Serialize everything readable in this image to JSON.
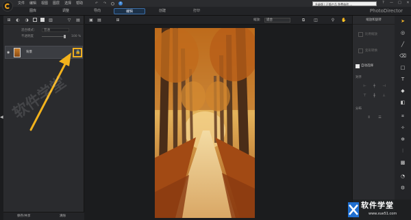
{
  "app": {
    "brand": "PhotoDirector"
  },
  "menu": [
    "文件",
    "编辑",
    "视图",
    "图层",
    "选择",
    "帮助"
  ],
  "notice": "升级版 | 正版产品 免费体验 ...",
  "window_controls": [
    "?",
    "—",
    "□",
    "✕"
  ],
  "tabs": [
    {
      "label": "图库",
      "active": false
    },
    {
      "label": "调整",
      "active": false
    },
    {
      "label": "导向",
      "active": false
    },
    {
      "label": "编辑",
      "active": true
    },
    {
      "label": "创建",
      "active": false
    },
    {
      "label": "打印",
      "active": false
    }
  ],
  "layers_panel": {
    "blend_label": "混合模式：",
    "blend_value": "普通",
    "opacity_label": "不透明度",
    "opacity_value": "100 %",
    "layer_name": "背景",
    "footer_save": "保存/共享",
    "footer_clear": "清除"
  },
  "canvas_toolbar": {
    "zoom_label": "缩放:",
    "zoom_value": "适合"
  },
  "right_panel": {
    "title": "缩放和旋转",
    "btn_ratio": "比例缩放",
    "btn_transform": "变形转换",
    "auto_select_label": "自动选择",
    "align_label": "对齐",
    "distribute_label": "分布"
  },
  "watermark": {
    "site_name": "软件学堂",
    "site_url": "www.xue51.com"
  },
  "colors": {
    "accent": "#f0b020",
    "active_tab": "#1c3148",
    "panel": "#2a2b2e"
  }
}
